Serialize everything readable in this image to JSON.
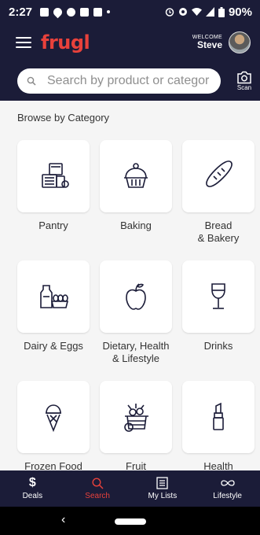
{
  "status_bar": {
    "time": "2:27",
    "battery": "90%"
  },
  "header": {
    "logo": "frugl",
    "welcome_label": "WELCOME",
    "user_name": "Steve"
  },
  "search": {
    "placeholder": "Search by product or categor",
    "scan_label": "Scan"
  },
  "browse": {
    "title": "Browse by Category",
    "categories": [
      {
        "label": "Pantry",
        "icon": "pantry-icon"
      },
      {
        "label": "Baking",
        "icon": "cupcake-icon"
      },
      {
        "label": "Bread\n& Bakery",
        "icon": "bread-icon"
      },
      {
        "label": "Dairy & Eggs",
        "icon": "milk-eggs-icon"
      },
      {
        "label": "Dietary, Health\n& Lifestyle",
        "icon": "apple-icon"
      },
      {
        "label": "Drinks",
        "icon": "wine-glass-icon"
      },
      {
        "label": "Frozen Food",
        "icon": "ice-cream-icon"
      },
      {
        "label": "Fruit",
        "icon": "fruit-basket-icon"
      },
      {
        "label": "Health",
        "icon": "lipstick-icon"
      }
    ]
  },
  "bottom_nav": {
    "items": [
      {
        "label": "Deals",
        "icon": "dollar-icon",
        "active": false
      },
      {
        "label": "Search",
        "icon": "search-icon",
        "active": true
      },
      {
        "label": "My Lists",
        "icon": "list-icon",
        "active": false
      },
      {
        "label": "Lifestyle",
        "icon": "infinity-icon",
        "active": false
      }
    ]
  },
  "colors": {
    "navy": "#1b1c38",
    "accent": "#e8413b",
    "background": "#f5f5f5"
  }
}
